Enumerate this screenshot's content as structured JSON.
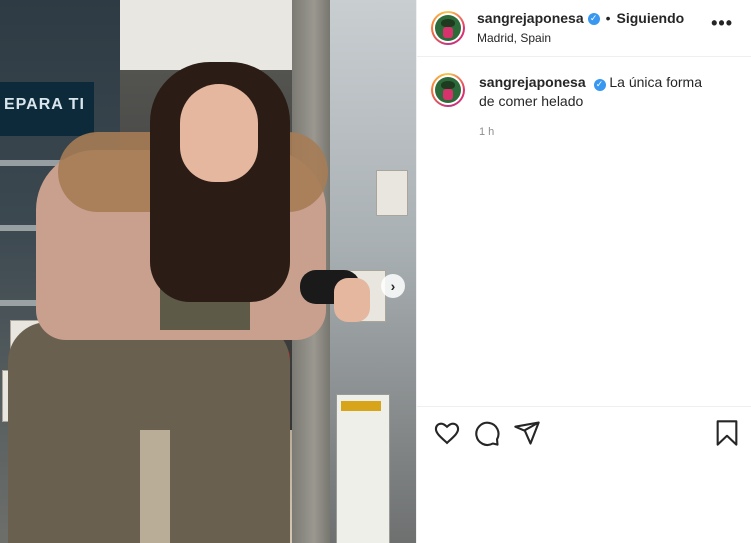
{
  "post": {
    "username": "sangrejaponesa",
    "verified_icon": "verified-badge-icon",
    "follow_separator": "•",
    "follow_status": "Siguiendo",
    "location": "Madrid, Spain",
    "more_icon": "•••",
    "caption_username": "sangrejaponesa",
    "caption_text": "La única forma de comer helado",
    "time_ago": "1 h",
    "carousel_next": "›",
    "shop_sign": "EPARA TI"
  },
  "icons": {
    "like": "heart-icon",
    "comment": "comment-icon",
    "share": "share-icon",
    "save": "bookmark-icon"
  },
  "colors": {
    "verified": "#3897f0",
    "text": "#262626",
    "muted": "#8e8e8e"
  }
}
